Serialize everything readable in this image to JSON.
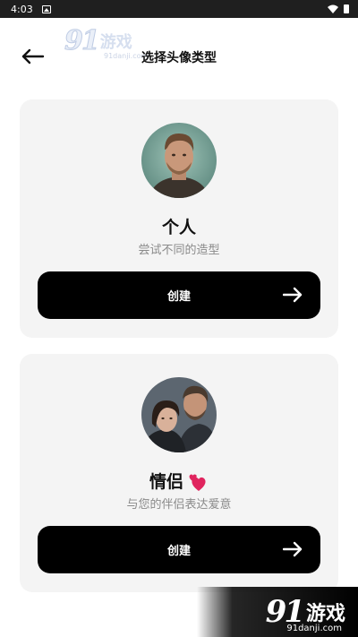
{
  "status_bar": {
    "time": "4:03"
  },
  "header": {
    "title": "选择头像类型"
  },
  "watermark_top": {
    "logo_num": "91",
    "logo_text": "游戏",
    "sub": "91danji.com"
  },
  "cards": [
    {
      "title": "个人",
      "subtitle": "尝试不同的造型",
      "button_label": "创建",
      "avatar": "man-portrait"
    },
    {
      "title": "情侣",
      "subtitle": "与您的伴侣表达爱意",
      "button_label": "创建",
      "avatar": "couple-portrait",
      "title_emoji": "two-hearts-icon"
    }
  ],
  "watermark_bottom": {
    "logo_num": "91",
    "logo_text": "游戏",
    "sub": "91danji.com"
  },
  "colors": {
    "card_bg": "#f4f4f4",
    "button_bg": "#000000",
    "button_text": "#ffffff",
    "subtitle": "#8a8a8a",
    "heart": "#e0245e"
  }
}
